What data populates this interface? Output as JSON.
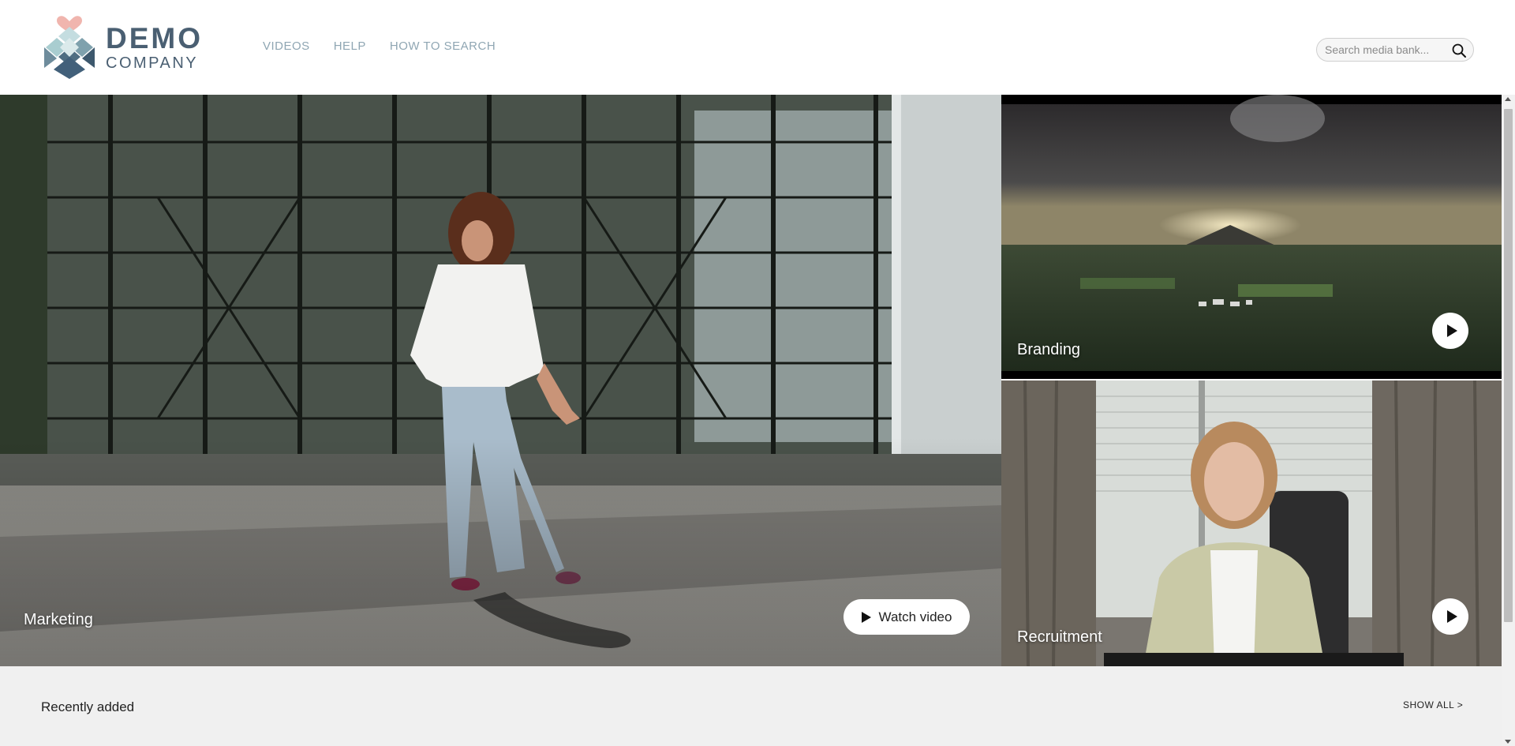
{
  "brand": {
    "line1": "DEMO",
    "line2": "COMPANY",
    "colors": {
      "text": "#4a5f72",
      "heart": "#f0b5ae",
      "diamonds": [
        "#a9cdd0",
        "#7fa1ad",
        "#4f6e82",
        "#c4dde0"
      ]
    }
  },
  "nav": {
    "items": [
      {
        "label": "VIDEOS"
      },
      {
        "label": "HELP"
      },
      {
        "label": "HOW TO SEARCH"
      }
    ]
  },
  "search": {
    "placeholder": "Search media bank...",
    "icon": "search-icon"
  },
  "hero": {
    "main": {
      "label": "Marketing",
      "button_label": "Watch video",
      "button_icon": "play-icon"
    },
    "tiles": [
      {
        "label": "Branding",
        "icon": "play-icon"
      },
      {
        "label": "Recruitment",
        "icon": "play-icon"
      }
    ]
  },
  "recent": {
    "title": "Recently added",
    "show_all": "SHOW ALL >"
  }
}
